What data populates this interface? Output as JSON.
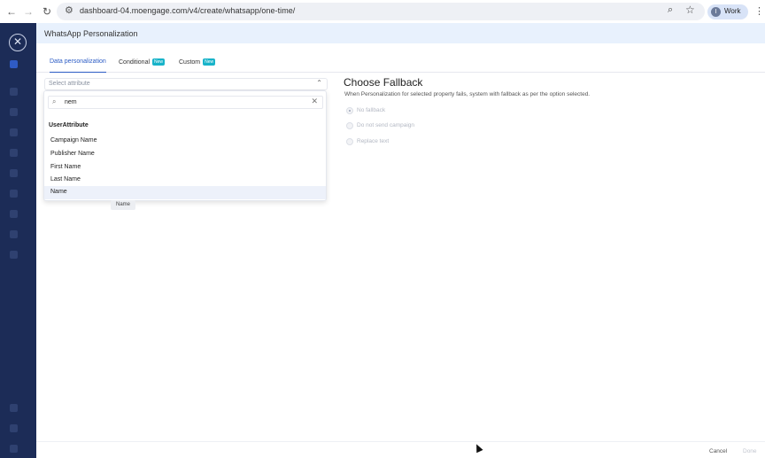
{
  "browser": {
    "url": "dashboard-04.moengage.com/v4/create/whatsapp/one-time/",
    "profile_initial": "I",
    "profile_label": "Work"
  },
  "panel": {
    "title": "WhatsApp Personalization"
  },
  "tabs": [
    {
      "label": "Data personalization",
      "active": true
    },
    {
      "label": "Conditional",
      "badge": "New"
    },
    {
      "label": "Custom",
      "badge": "New"
    }
  ],
  "attribute_select": {
    "placeholder": "Select attribute"
  },
  "dropdown": {
    "search_value": "nem",
    "group_label": "UserAttribute",
    "options": [
      {
        "label": "Campaign Name"
      },
      {
        "label": "Publisher Name"
      },
      {
        "label": "First Name"
      },
      {
        "label": "Last Name"
      },
      {
        "label": "Name",
        "highlighted": true
      }
    ],
    "tooltip": "Name"
  },
  "fallback": {
    "title": "Choose Fallback",
    "description": "When Personalization for selected property fails, system with fallback as per the option selected.",
    "options": [
      {
        "label": "No fallback",
        "selected": true
      },
      {
        "label": "Do not send campaign"
      },
      {
        "label": "Replace text"
      }
    ]
  },
  "footer": {
    "cancel_label": "Cancel",
    "done_label": "Done"
  },
  "colors": {
    "sidebar_bg": "#1c2c57",
    "accent": "#2c5cc5",
    "badge": "#18b3c9",
    "titlebar_bg": "#e8f1fd"
  }
}
